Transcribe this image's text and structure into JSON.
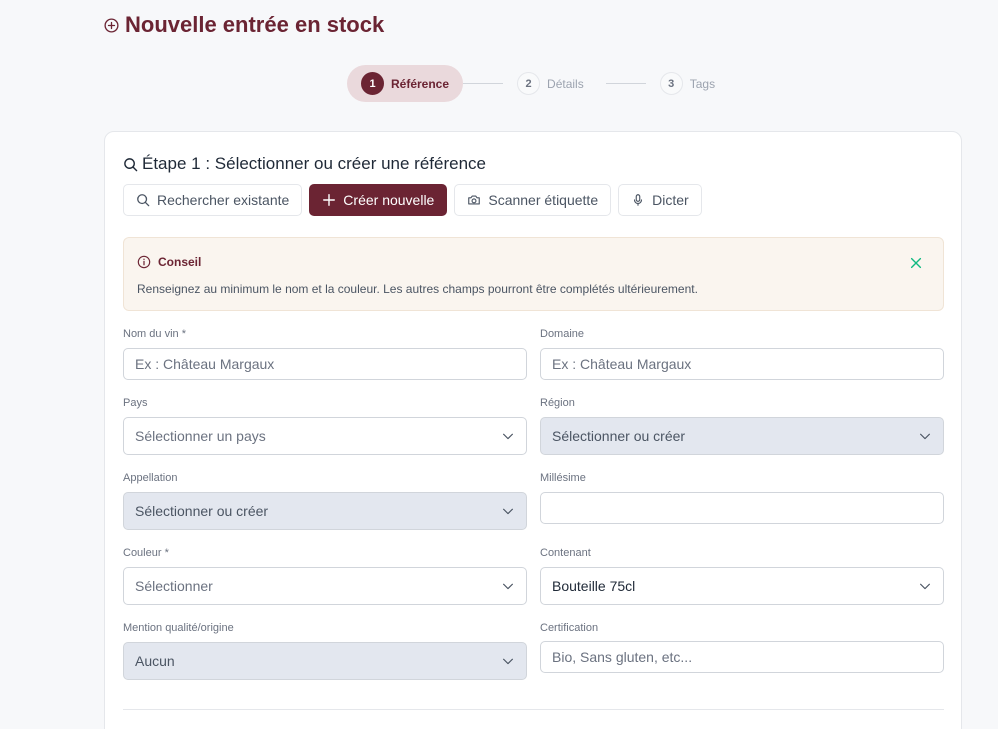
{
  "page": {
    "title": "Nouvelle entrée en stock"
  },
  "stepper": {
    "steps": [
      {
        "num": "1",
        "label": "Référence",
        "active": true
      },
      {
        "num": "2",
        "label": "Détails",
        "active": false
      },
      {
        "num": "3",
        "label": "Tags",
        "active": false
      }
    ]
  },
  "card": {
    "heading": "Étape 1 : Sélectionner ou créer une référence",
    "modes": [
      {
        "label": "Rechercher existante",
        "icon": "search-icon"
      },
      {
        "label": "Créer nouvelle",
        "icon": "plus-icon",
        "active": true
      },
      {
        "label": "Scanner étiquette",
        "icon": "camera-icon"
      },
      {
        "label": "Dicter",
        "icon": "mic-icon"
      }
    ]
  },
  "tip": {
    "title": "Conseil",
    "text": "Renseignez au minimum le nom et la couleur. Les autres champs pourront être complétés ultérieurement."
  },
  "form": {
    "nom_vin": {
      "label": "Nom du vin *",
      "placeholder": "Ex : Château Margaux",
      "value": ""
    },
    "domaine": {
      "label": "Domaine",
      "placeholder": "Ex : Château Margaux",
      "value": ""
    },
    "pays": {
      "label": "Pays",
      "value": "Sélectionner un pays"
    },
    "region": {
      "label": "Région",
      "value": "Sélectionner ou créer"
    },
    "appellation": {
      "label": "Appellation",
      "value": "Sélectionner ou créer"
    },
    "millesime": {
      "label": "Millésime",
      "value": ""
    },
    "couleur": {
      "label": "Couleur *",
      "value": "Sélectionner"
    },
    "contenant": {
      "label": "Contenant",
      "value": "Bouteille 75cl"
    },
    "mention": {
      "label": "Mention qualité/origine",
      "value": "Aucun"
    },
    "certification": {
      "label": "Certification",
      "placeholder": "Bio, Sans gluten, etc...",
      "value": ""
    }
  },
  "colors": {
    "brand": "#6b2433",
    "brand_soft": "#ead9dc",
    "tip_bg": "#faf5ef",
    "close_icon": "#10b981",
    "disabled_bg": "#e3e7ef"
  }
}
